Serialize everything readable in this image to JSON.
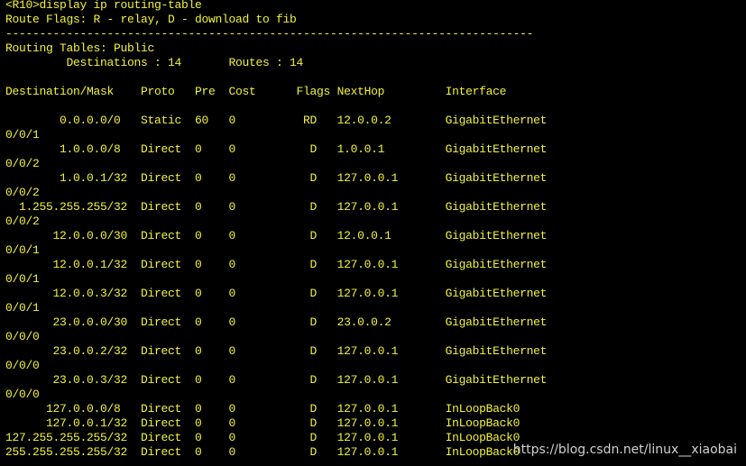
{
  "colors": {
    "background": "#000000",
    "terminal_text": "#f2f23a",
    "watermark": "#d0d0d0"
  },
  "terminal": {
    "lines": [
      "<R10>display ip routing-table",
      "Route Flags: R - relay, D - download to fib",
      "------------------------------------------------------------------------------",
      "Routing Tables: Public",
      "         Destinations : 14       Routes : 14",
      "",
      "Destination/Mask    Proto   Pre  Cost      Flags NextHop         Interface",
      "",
      "        0.0.0.0/0   Static  60   0          RD   12.0.0.2        GigabitEthernet",
      "0/0/1",
      "        1.0.0.0/8   Direct  0    0           D   1.0.0.1         GigabitEthernet",
      "0/0/2",
      "        1.0.0.1/32  Direct  0    0           D   127.0.0.1       GigabitEthernet",
      "0/0/2",
      "  1.255.255.255/32  Direct  0    0           D   127.0.0.1       GigabitEthernet",
      "0/0/2",
      "       12.0.0.0/30  Direct  0    0           D   12.0.0.1        GigabitEthernet",
      "0/0/1",
      "       12.0.0.1/32  Direct  0    0           D   127.0.0.1       GigabitEthernet",
      "0/0/1",
      "       12.0.0.3/32  Direct  0    0           D   127.0.0.1       GigabitEthernet",
      "0/0/1",
      "       23.0.0.0/30  Direct  0    0           D   23.0.0.2        GigabitEthernet",
      "0/0/0",
      "       23.0.0.2/32  Direct  0    0           D   127.0.0.1       GigabitEthernet",
      "0/0/0",
      "       23.0.0.3/32  Direct  0    0           D   127.0.0.1       GigabitEthernet",
      "0/0/0",
      "      127.0.0.0/8   Direct  0    0           D   127.0.0.1       InLoopBack0",
      "      127.0.0.1/32  Direct  0    0           D   127.0.0.1       InLoopBack0",
      "127.255.255.255/32  Direct  0    0           D   127.0.0.1       InLoopBack0",
      "255.255.255.255/32  Direct  0    0           D   127.0.0.1       InLoopBack0"
    ]
  },
  "watermark": {
    "text": "https://blog.csdn.net/linux__xiaobai"
  }
}
